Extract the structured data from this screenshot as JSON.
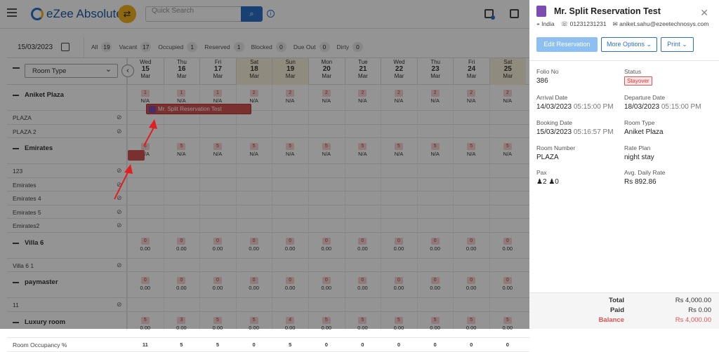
{
  "app": {
    "name": "eZee Absolute",
    "search_placeholder": "Quick Search"
  },
  "filter": {
    "date": "15/03/2023",
    "stats": [
      {
        "label": "All",
        "count": "19"
      },
      {
        "label": "Vacant",
        "count": "17"
      },
      {
        "label": "Occupied",
        "count": "1"
      },
      {
        "label": "Reserved",
        "count": "1"
      },
      {
        "label": "Blocked",
        "count": "0"
      },
      {
        "label": "Due Out",
        "count": "0"
      },
      {
        "label": "Dirty",
        "count": "0"
      }
    ]
  },
  "grid": {
    "room_type_label": "Room Type",
    "days": [
      {
        "dow": "Wed",
        "d": "15",
        "m": "Mar"
      },
      {
        "dow": "Thu",
        "d": "16",
        "m": "Mar"
      },
      {
        "dow": "Fri",
        "d": "17",
        "m": "Mar"
      },
      {
        "dow": "Sat",
        "d": "18",
        "m": "Mar"
      },
      {
        "dow": "Sun",
        "d": "19",
        "m": "Mar"
      },
      {
        "dow": "Mon",
        "d": "20",
        "m": "Mar"
      },
      {
        "dow": "Tue",
        "d": "21",
        "m": "Mar"
      },
      {
        "dow": "Wed",
        "d": "22",
        "m": "Mar"
      },
      {
        "dow": "Thu",
        "d": "23",
        "m": "Mar"
      },
      {
        "dow": "Fri",
        "d": "24",
        "m": "Mar"
      },
      {
        "dow": "Sat",
        "d": "25",
        "m": "Mar"
      }
    ],
    "groups": [
      {
        "name": "Aniket Plaza",
        "avail": [
          "1",
          "1",
          "1",
          "2",
          "2",
          "2",
          "2",
          "2",
          "2",
          "2",
          "2"
        ],
        "rate": "N/A",
        "rooms": [
          "PLAZA",
          "PLAZA 2"
        ]
      },
      {
        "name": "Emirates",
        "avail": [
          "5",
          "5",
          "5",
          "5",
          "5",
          "5",
          "5",
          "5",
          "5",
          "5",
          "5"
        ],
        "rate": "N/A",
        "rooms": [
          "123",
          "Emirates",
          "Emirates 4",
          "Emirates 5",
          "Emirates2"
        ]
      },
      {
        "name": "Villa 6",
        "avail": [
          "0",
          "0",
          "0",
          "0",
          "0",
          "0",
          "0",
          "0",
          "0",
          "0",
          "0"
        ],
        "rate": "0.00",
        "rooms": [
          "Villa 6 1"
        ]
      },
      {
        "name": "paymaster",
        "avail": [
          "0",
          "0",
          "0",
          "0",
          "0",
          "0",
          "0",
          "0",
          "0",
          "0",
          "0"
        ],
        "rate": "0.00",
        "rooms": [
          "11"
        ]
      },
      {
        "name": "Luxury room",
        "avail": [
          "5",
          "3",
          "5",
          "5",
          "4",
          "5",
          "5",
          "5",
          "5",
          "5",
          "5"
        ],
        "rate": "0.00",
        "rooms": []
      }
    ],
    "occupancy_label": "Room Occupancy %",
    "occupancy": [
      "11",
      "5",
      "5",
      "0",
      "5",
      "0",
      "0",
      "0",
      "0",
      "0",
      "0"
    ],
    "reservation_label": "Mr. Split Reservation Test",
    "reservation_badge": "4"
  },
  "panel": {
    "title": "Mr. Split Reservation Test",
    "country": "India",
    "phone": "01231231231",
    "email": "aniket.sahu@ezeetechnosys.com",
    "buttons": {
      "edit": "Edit Reservation",
      "more": "More Options",
      "print": "Print"
    },
    "fields": [
      {
        "label": "Folio No",
        "value": "386"
      },
      {
        "label": "Status",
        "value": "Stayover"
      },
      {
        "label": "Arrival Date",
        "value": "14/03/2023",
        "time": "05:15:00 PM"
      },
      {
        "label": "Departure Date",
        "value": "18/03/2023",
        "time": "05:15:00 PM"
      },
      {
        "label": "Booking Date",
        "value": "15/03/2023",
        "time": "05:16:57 PM"
      },
      {
        "label": "Room Type",
        "value": "Aniket Plaza"
      },
      {
        "label": "Room Number",
        "value": "PLAZA"
      },
      {
        "label": "Rate Plan",
        "value": "night stay"
      },
      {
        "label": "Pax",
        "adults": "2",
        "children": "0"
      },
      {
        "label": "Avg. Daily Rate",
        "value": "Rs 892.86"
      }
    ],
    "totals": [
      {
        "label": "Total",
        "value": "Rs 4,000.00"
      },
      {
        "label": "Paid",
        "value": "Rs 0.00"
      },
      {
        "label": "Balance",
        "value": "Rs 4,000.00"
      }
    ]
  },
  "colors": {
    "accent": "#2a6fc9",
    "badge": "#e05252",
    "weekend": "#f7efd9"
  }
}
